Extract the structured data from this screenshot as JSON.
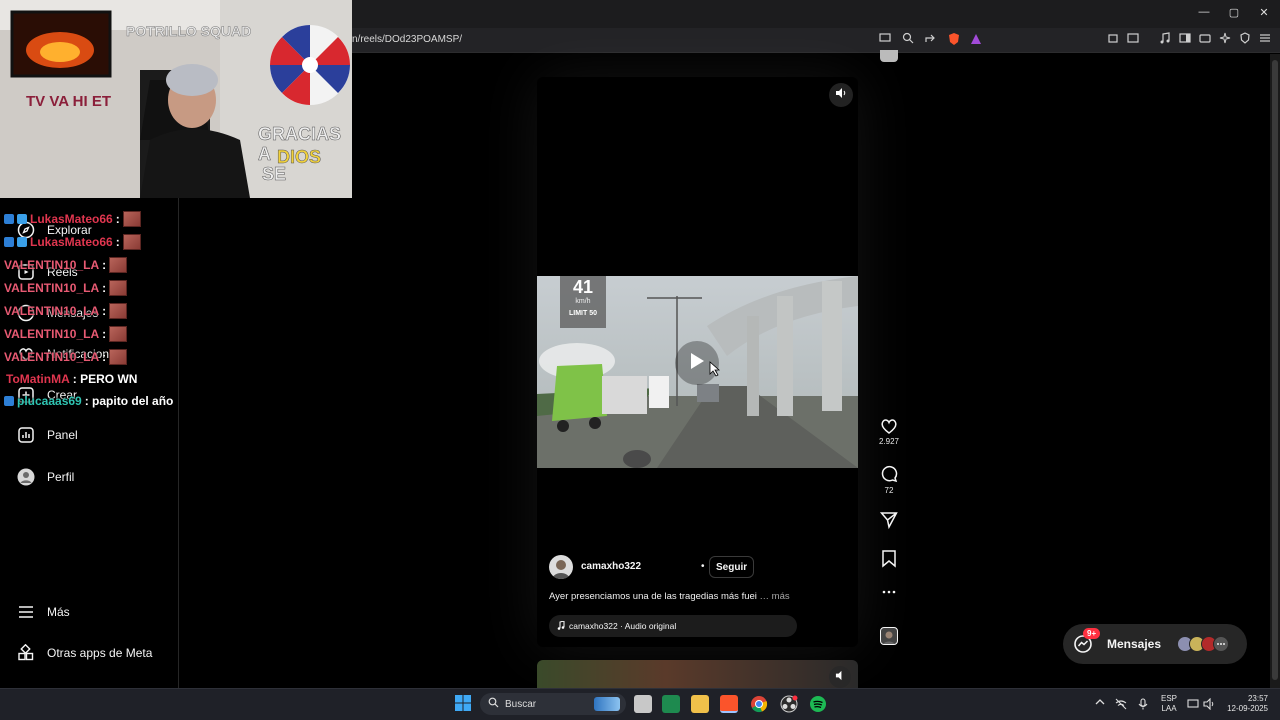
{
  "browser": {
    "url": "n/reels/DOd23POAMSP/",
    "window_controls": [
      "—",
      "▢",
      "✕"
    ]
  },
  "sidebar": {
    "items": [
      {
        "label": "Explorar",
        "icon": "compass-icon"
      },
      {
        "label": "Reels",
        "icon": "reels-icon"
      },
      {
        "label": "Mensajes",
        "icon": "messenger-icon"
      },
      {
        "label": "Notificaciones",
        "icon": "heart-icon"
      },
      {
        "label": "Crear",
        "icon": "plus-square-icon"
      },
      {
        "label": "Panel",
        "icon": "chart-icon"
      },
      {
        "label": "Perfil",
        "icon": "avatar-icon"
      }
    ],
    "bottom": [
      {
        "label": "Más",
        "icon": "menu-icon"
      },
      {
        "label": "Otras apps de Meta",
        "icon": "grid-icon"
      }
    ]
  },
  "chat": [
    {
      "user": "LukasMateo66",
      "text": ":",
      "color": "#e0364f"
    },
    {
      "user": "LukasMateo66",
      "text": ":",
      "color": "#e0364f"
    },
    {
      "user": "VALENTIN10_LA",
      "text": ":",
      "color": "#e85a73"
    },
    {
      "user": "VALENTIN10_LA",
      "text": ":",
      "color": "#e85a73"
    },
    {
      "user": "VALENTIN10_LA",
      "text": ":",
      "color": "#e85a73"
    },
    {
      "user": "VALENTIN10_LA",
      "text": ":",
      "color": "#e85a73"
    },
    {
      "user": "VALENTIN10_LA",
      "text": ":",
      "color": "#e85a73"
    },
    {
      "user": "ToMatinMA",
      "text": ": PERO WN",
      "color": "#e0364f"
    },
    {
      "user": "plucaaas69",
      "text": ": papito del año",
      "color": "#2fc4b2"
    }
  ],
  "reel": {
    "speed_value": "41",
    "speed_unit": "km/h",
    "speed_limit": "LIMIT 50",
    "likes": "2.927",
    "comments": "72",
    "username": "camaxho322",
    "follow_label": "Seguir",
    "caption": "Ayer presenciamos una de las tragedias más fuei",
    "more_label": "… más",
    "audio": "camaxho322 · Audio original"
  },
  "webcam": {
    "sign_top": "POTRILLO SQUAD",
    "sign_banner": "TV VA HI ET",
    "sign_gracias": "GRACIAS",
    "sign_a": "A",
    "sign_dios": "DIOS",
    "sign_se": "SE"
  },
  "messages": {
    "label": "Mensajes",
    "badge": "9+"
  },
  "taskbar": {
    "search_placeholder": "Buscar",
    "lang_top": "ESP",
    "lang_bottom": "LAA",
    "time": "23:57",
    "date": "12-09-2025"
  },
  "colors": {
    "accent_red": "#ff3040",
    "chat_red": "#e0364f",
    "chat_teal": "#2fc4b2"
  }
}
